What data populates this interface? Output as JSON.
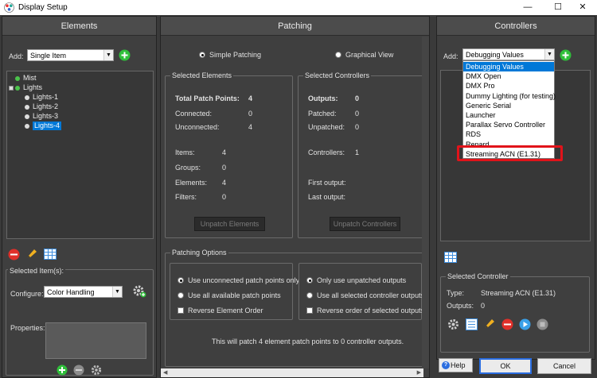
{
  "window": {
    "title": "Display Setup",
    "minimize_glyph": "—",
    "maximize_glyph": "☐",
    "close_glyph": "✕",
    "icons": {
      "app": "palette-app-icon"
    }
  },
  "elements_panel": {
    "header": "Elements",
    "add_label": "Add:",
    "add_value": "Single Item",
    "tree": {
      "mist": "Mist",
      "lights": "Lights",
      "children": [
        "Lights-1",
        "Lights-2",
        "Lights-3",
        "Lights-4"
      ]
    },
    "selected_items_title": "Selected Item(s):",
    "configure_label": "Configure:",
    "configure_value": "Color Handling",
    "properties_label": "Properties:"
  },
  "patching_panel": {
    "header": "Patching",
    "simple_patching": "Simple Patching",
    "graphical_view": "Graphical View",
    "selected_elements": {
      "title": "Selected Elements",
      "total_label": "Total Patch Points:",
      "total_value": "4",
      "connected_label": "Connected:",
      "connected_value": "0",
      "unconnected_label": "Unconnected:",
      "unconnected_value": "4",
      "items_label": "Items:",
      "items_value": "4",
      "groups_label": "Groups:",
      "groups_value": "0",
      "elements_label": "Elements:",
      "elements_value": "4",
      "filters_label": "Filters:",
      "filters_value": "0",
      "unpatch_button": "Unpatch Elements"
    },
    "selected_controllers": {
      "title": "Selected Controllers",
      "outputs_label": "Outputs:",
      "outputs_value": "0",
      "patched_label": "Patched:",
      "patched_value": "0",
      "unpatched_label": "Unpatched:",
      "unpatched_value": "0",
      "controllers_label": "Controllers:",
      "controllers_value": "1",
      "first_output_label": "First output:",
      "last_output_label": "Last output:",
      "unpatch_button": "Unpatch Controllers"
    },
    "options": {
      "title": "Patching Options",
      "use_unconnected": "Use unconnected patch points only",
      "use_all_available": "Use all available patch points",
      "reverse_element": "Reverse Element Order",
      "only_unpatched": "Only use unpatched outputs",
      "use_all_selected": "Use all selected controller outputs",
      "reverse_selected": "Reverse order of selected outputs",
      "summary": "This will patch 4 element patch points to 0 controller outputs."
    }
  },
  "controllers_panel": {
    "header": "Controllers",
    "add_label": "Add:",
    "add_value": "Debugging Values",
    "dropdown_options": [
      "Debugging Values",
      "DMX Open",
      "DMX Pro",
      "Dummy Lighting (for testing)",
      "Generic Serial",
      "Launcher",
      "Parallax Servo Controller",
      "RDS",
      "Renard",
      "Streaming ACN (E1.31)"
    ],
    "selected_controller": {
      "title": "Selected Controller",
      "type_label": "Type:",
      "type_value": "Streaming ACN (E1.31)",
      "outputs_label": "Outputs:",
      "outputs_value": "0"
    }
  },
  "footer": {
    "help": "Help",
    "ok": "OK",
    "cancel": "Cancel"
  },
  "colors": {
    "panel_bg": "#3f3f3f",
    "header_bg": "#4c4c4c",
    "add_green": "#2fbf3a",
    "remove_red": "#e0302a",
    "highlight_red": "#e1131a",
    "selection_blue": "#0078d7"
  }
}
